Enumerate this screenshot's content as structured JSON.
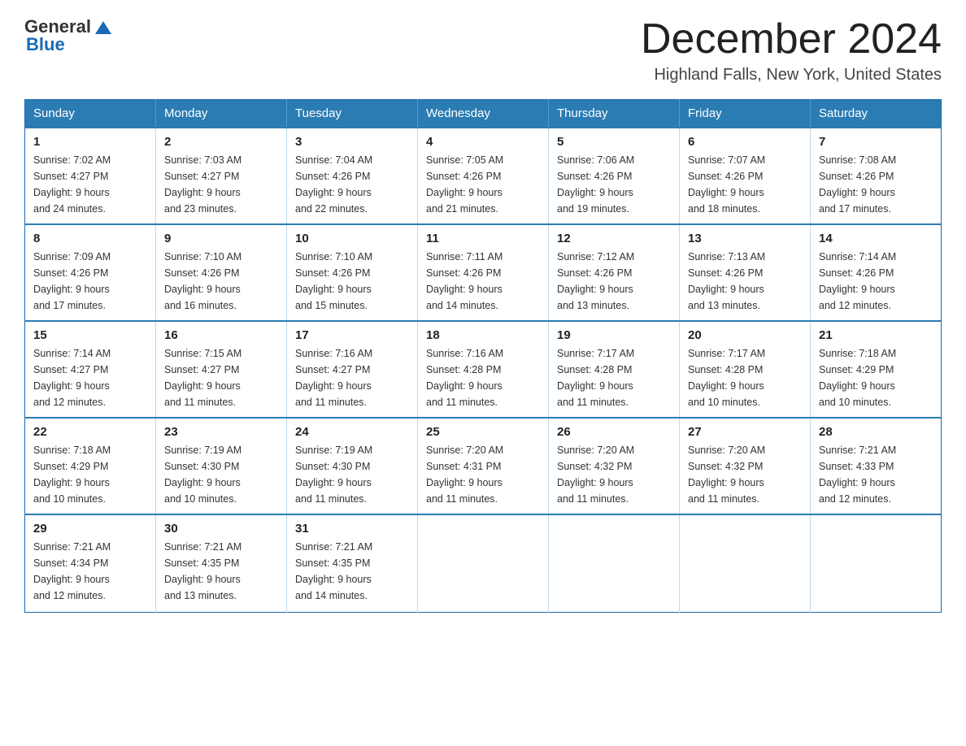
{
  "header": {
    "logo": {
      "general": "General",
      "blue": "Blue"
    },
    "title": "December 2024",
    "location": "Highland Falls, New York, United States"
  },
  "weekdays": [
    "Sunday",
    "Monday",
    "Tuesday",
    "Wednesday",
    "Thursday",
    "Friday",
    "Saturday"
  ],
  "weeks": [
    [
      {
        "day": "1",
        "sunrise": "7:02 AM",
        "sunset": "4:27 PM",
        "daylight": "9 hours and 24 minutes."
      },
      {
        "day": "2",
        "sunrise": "7:03 AM",
        "sunset": "4:27 PM",
        "daylight": "9 hours and 23 minutes."
      },
      {
        "day": "3",
        "sunrise": "7:04 AM",
        "sunset": "4:26 PM",
        "daylight": "9 hours and 22 minutes."
      },
      {
        "day": "4",
        "sunrise": "7:05 AM",
        "sunset": "4:26 PM",
        "daylight": "9 hours and 21 minutes."
      },
      {
        "day": "5",
        "sunrise": "7:06 AM",
        "sunset": "4:26 PM",
        "daylight": "9 hours and 19 minutes."
      },
      {
        "day": "6",
        "sunrise": "7:07 AM",
        "sunset": "4:26 PM",
        "daylight": "9 hours and 18 minutes."
      },
      {
        "day": "7",
        "sunrise": "7:08 AM",
        "sunset": "4:26 PM",
        "daylight": "9 hours and 17 minutes."
      }
    ],
    [
      {
        "day": "8",
        "sunrise": "7:09 AM",
        "sunset": "4:26 PM",
        "daylight": "9 hours and 17 minutes."
      },
      {
        "day": "9",
        "sunrise": "7:10 AM",
        "sunset": "4:26 PM",
        "daylight": "9 hours and 16 minutes."
      },
      {
        "day": "10",
        "sunrise": "7:10 AM",
        "sunset": "4:26 PM",
        "daylight": "9 hours and 15 minutes."
      },
      {
        "day": "11",
        "sunrise": "7:11 AM",
        "sunset": "4:26 PM",
        "daylight": "9 hours and 14 minutes."
      },
      {
        "day": "12",
        "sunrise": "7:12 AM",
        "sunset": "4:26 PM",
        "daylight": "9 hours and 13 minutes."
      },
      {
        "day": "13",
        "sunrise": "7:13 AM",
        "sunset": "4:26 PM",
        "daylight": "9 hours and 13 minutes."
      },
      {
        "day": "14",
        "sunrise": "7:14 AM",
        "sunset": "4:26 PM",
        "daylight": "9 hours and 12 minutes."
      }
    ],
    [
      {
        "day": "15",
        "sunrise": "7:14 AM",
        "sunset": "4:27 PM",
        "daylight": "9 hours and 12 minutes."
      },
      {
        "day": "16",
        "sunrise": "7:15 AM",
        "sunset": "4:27 PM",
        "daylight": "9 hours and 11 minutes."
      },
      {
        "day": "17",
        "sunrise": "7:16 AM",
        "sunset": "4:27 PM",
        "daylight": "9 hours and 11 minutes."
      },
      {
        "day": "18",
        "sunrise": "7:16 AM",
        "sunset": "4:28 PM",
        "daylight": "9 hours and 11 minutes."
      },
      {
        "day": "19",
        "sunrise": "7:17 AM",
        "sunset": "4:28 PM",
        "daylight": "9 hours and 11 minutes."
      },
      {
        "day": "20",
        "sunrise": "7:17 AM",
        "sunset": "4:28 PM",
        "daylight": "9 hours and 10 minutes."
      },
      {
        "day": "21",
        "sunrise": "7:18 AM",
        "sunset": "4:29 PM",
        "daylight": "9 hours and 10 minutes."
      }
    ],
    [
      {
        "day": "22",
        "sunrise": "7:18 AM",
        "sunset": "4:29 PM",
        "daylight": "9 hours and 10 minutes."
      },
      {
        "day": "23",
        "sunrise": "7:19 AM",
        "sunset": "4:30 PM",
        "daylight": "9 hours and 10 minutes."
      },
      {
        "day": "24",
        "sunrise": "7:19 AM",
        "sunset": "4:30 PM",
        "daylight": "9 hours and 11 minutes."
      },
      {
        "day": "25",
        "sunrise": "7:20 AM",
        "sunset": "4:31 PM",
        "daylight": "9 hours and 11 minutes."
      },
      {
        "day": "26",
        "sunrise": "7:20 AM",
        "sunset": "4:32 PM",
        "daylight": "9 hours and 11 minutes."
      },
      {
        "day": "27",
        "sunrise": "7:20 AM",
        "sunset": "4:32 PM",
        "daylight": "9 hours and 11 minutes."
      },
      {
        "day": "28",
        "sunrise": "7:21 AM",
        "sunset": "4:33 PM",
        "daylight": "9 hours and 12 minutes."
      }
    ],
    [
      {
        "day": "29",
        "sunrise": "7:21 AM",
        "sunset": "4:34 PM",
        "daylight": "9 hours and 12 minutes."
      },
      {
        "day": "30",
        "sunrise": "7:21 AM",
        "sunset": "4:35 PM",
        "daylight": "9 hours and 13 minutes."
      },
      {
        "day": "31",
        "sunrise": "7:21 AM",
        "sunset": "4:35 PM",
        "daylight": "9 hours and 14 minutes."
      },
      null,
      null,
      null,
      null
    ]
  ],
  "labels": {
    "sunrise": "Sunrise:",
    "sunset": "Sunset:",
    "daylight": "Daylight:"
  }
}
